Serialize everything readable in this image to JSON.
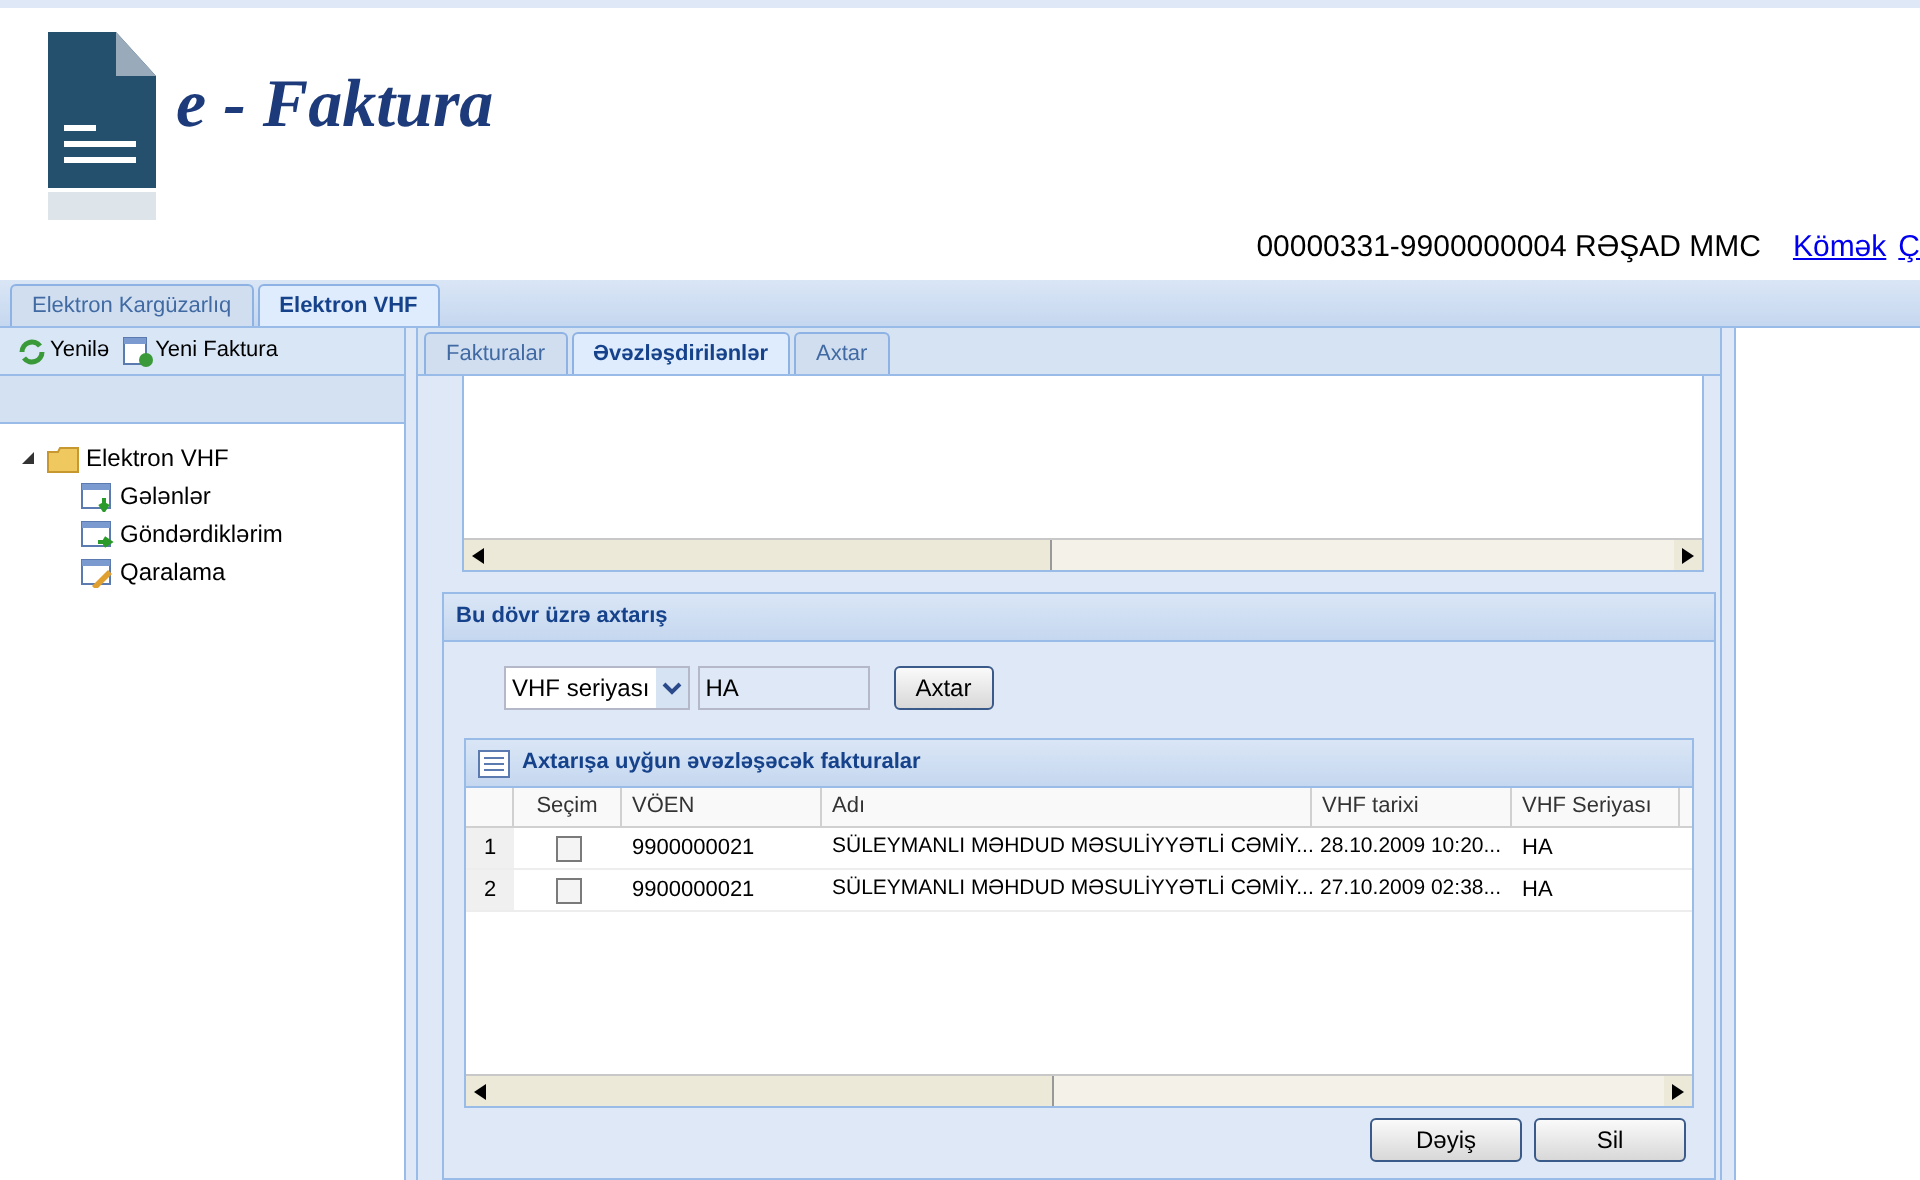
{
  "header": {
    "logo_text": "e - Faktura",
    "user": "00000331-9900000004 RƏŞAD MMC",
    "links": [
      "Kömək",
      "Ç"
    ]
  },
  "top_tabs": [
    {
      "label": "Elektron Kargüzarlıq",
      "selected": false
    },
    {
      "label": "Elektron VHF",
      "selected": true
    }
  ],
  "sidebar": {
    "toolbar": [
      "Yenilə",
      "Yeni Faktura"
    ],
    "tree": [
      {
        "label": "Elektron VHF",
        "expanded": true,
        "children": [
          {
            "label": "Gələnlər",
            "kind": "inbox"
          },
          {
            "label": "Göndərdiklərim",
            "kind": "sent"
          },
          {
            "label": "Qaralama",
            "kind": "draft"
          }
        ]
      }
    ]
  },
  "tabs": [
    {
      "label": "Fakturalar",
      "selected": false
    },
    {
      "label": "Əvəzləşdirilənlər",
      "selected": true
    },
    {
      "label": "Axtar",
      "selected": false
    }
  ],
  "search_panel": {
    "title": "Bu dövr üzrə axtarış",
    "field_select": "VHF seriyası",
    "query": "HA",
    "search_button": "Axtar"
  },
  "results": {
    "title": "Axtarışa uyğun əvəzləşəcək fakturalar",
    "columns": [
      "Seçim",
      "VÖEN",
      "Adı",
      "VHF tarixi",
      "VHF Seriyası"
    ],
    "rows": [
      {
        "num": "1",
        "checked": false,
        "voen": "9900000021",
        "name": "SÜLEYMANLI MƏHDUD MƏSULİYYƏTLİ CƏMİY...",
        "date": "28.10.2009 10:20...",
        "series": "HA"
      },
      {
        "num": "2",
        "checked": false,
        "voen": "9900000021",
        "name": "SÜLEYMANLI MƏHDUD MƏSULİYYƏTLİ CƏMİY...",
        "date": "27.10.2009 02:38...",
        "series": "HA"
      }
    ]
  },
  "buttons": [
    "Dəyiş",
    "Sil"
  ]
}
